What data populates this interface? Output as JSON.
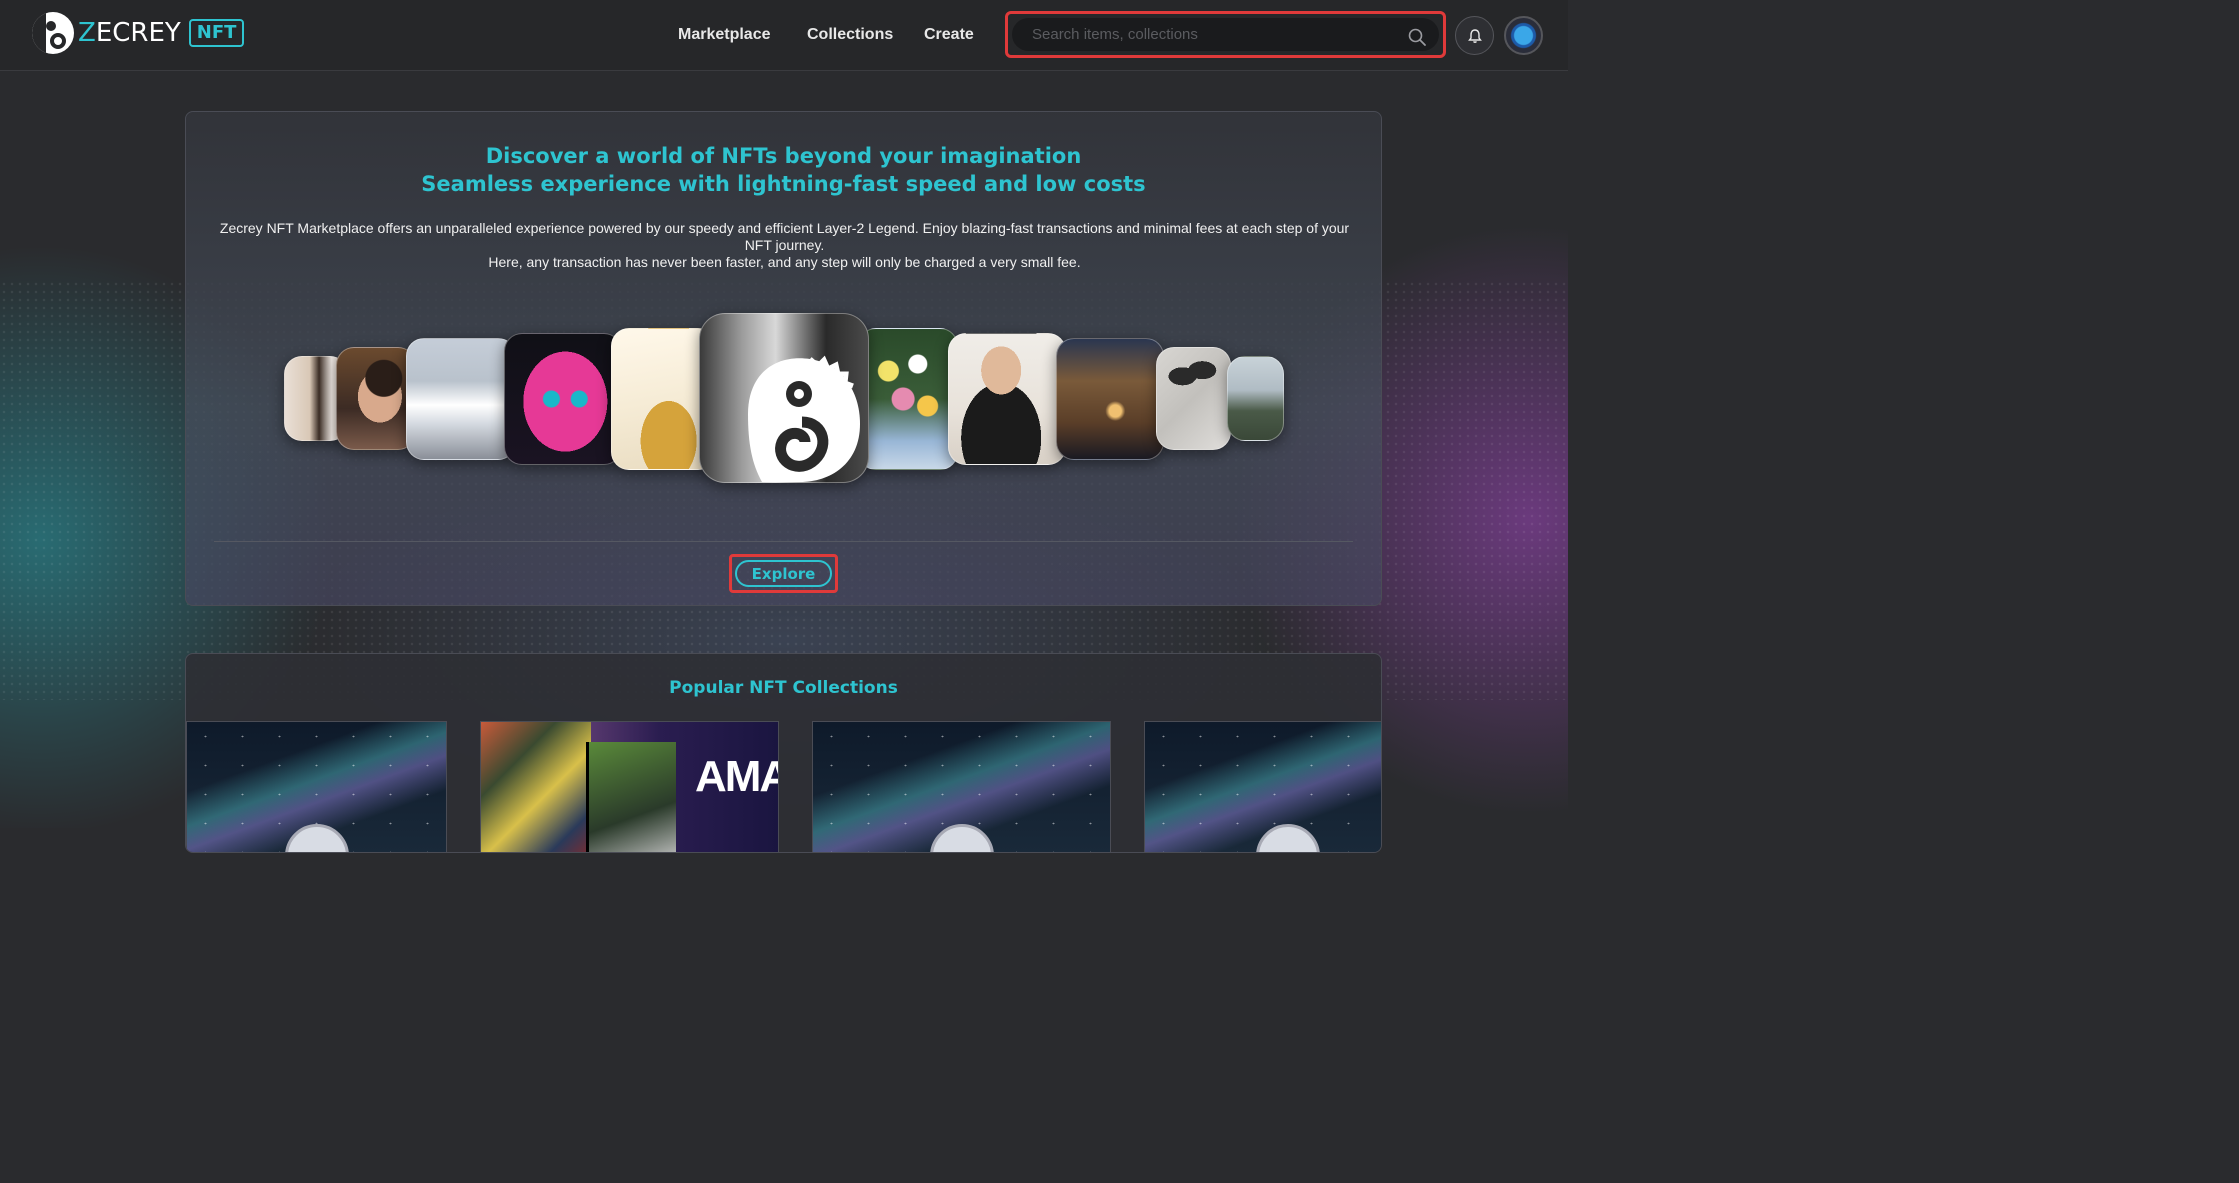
{
  "header": {
    "logo_text_prefix": "Z",
    "logo_text_rest": "ECREY",
    "logo_badge": "NFT",
    "nav": [
      {
        "label": "Marketplace"
      },
      {
        "label": "Collections"
      },
      {
        "label": "Create"
      }
    ],
    "search_placeholder": "Search items, collections"
  },
  "hero": {
    "title_line1": "Discover a world of NFTs beyond your imagination",
    "title_line2": "Seamless experience with lightning-fast speed and low costs",
    "description_line1": "Zecrey NFT Marketplace offers an unparalleled experience powered by our speedy and efficient Layer-2 Legend. Enjoy blazing-fast transactions and minimal fees at each step of your NFT journey.",
    "description_line2": "Here, any transaction has never been faster, and any step will only be charged a very small fee.",
    "explore_label": "Explore",
    "carousel": [
      {
        "name": "girl-portrait-image"
      },
      {
        "name": "boy-portrait-image"
      },
      {
        "name": "snowy-city-image"
      },
      {
        "name": "neon-cat-image"
      },
      {
        "name": "pineapple-image"
      },
      {
        "name": "zecrey-logo-image"
      },
      {
        "name": "flowers-image"
      },
      {
        "name": "man-portrait-image"
      },
      {
        "name": "house-night-image"
      },
      {
        "name": "slippers-floor-image"
      },
      {
        "name": "tower-landscape-image"
      }
    ]
  },
  "popular": {
    "title": "Popular NFT Collections",
    "banner_text": "AMA"
  },
  "colors": {
    "accent": "#2ec4d0",
    "highlight": "#e03a3a",
    "background": "#2a2b2e"
  }
}
